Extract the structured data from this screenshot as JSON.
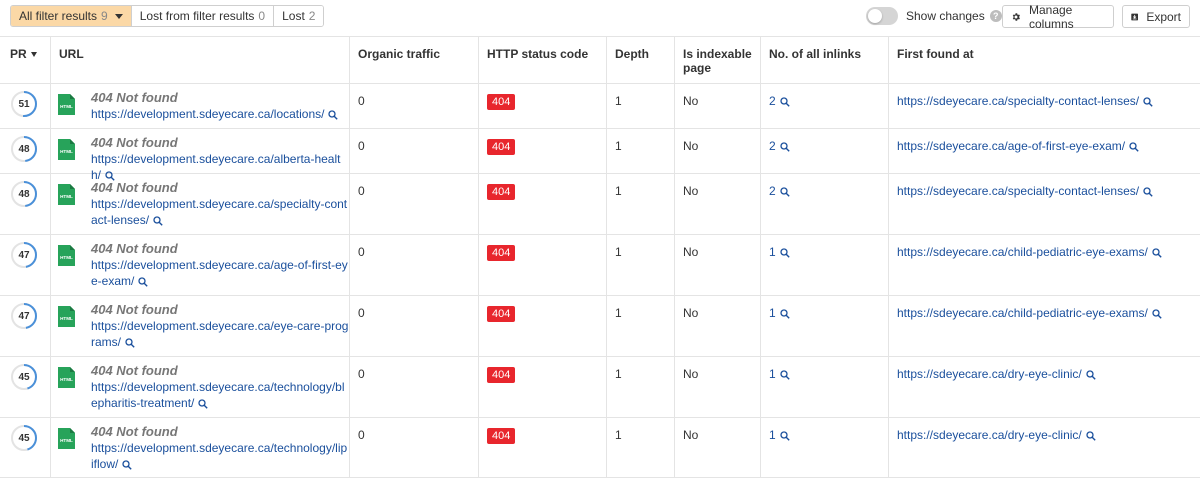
{
  "filters": {
    "all_label": "All filter results",
    "all_count": "9",
    "lost_filter_label": "Lost from filter results",
    "lost_filter_count": "0",
    "lost_label": "Lost",
    "lost_count": "2"
  },
  "toolbar": {
    "show_changes_label": "Show changes",
    "help_glyph": "?",
    "manage_columns_label": "Manage columns",
    "export_label": "Export"
  },
  "columns": {
    "pr": "PR",
    "url": "URL",
    "organic": "Organic traffic",
    "http": "HTTP status code",
    "depth": "Depth",
    "indexable": "Is indexable page",
    "inlinks": "No. of all inlinks",
    "first_found": "First found at"
  },
  "colors": {
    "accent_filter": "#fbd8a6",
    "status_404": "#e8262d",
    "link": "#1a4f9c",
    "pr_ring": "#4a90d9"
  },
  "rows": [
    {
      "pr": "51",
      "title": "404 Not found",
      "url": "https://development.sdeyecare.ca/locations/",
      "organic": "0",
      "http": "404",
      "depth": "1",
      "indexable": "No",
      "inlinks": "2",
      "first_found": "https://sdeyecare.ca/specialty-contact-lenses/"
    },
    {
      "pr": "48",
      "title": "404 Not found",
      "url": "https://development.sdeyecare.ca/alberta-health/",
      "organic": "0",
      "http": "404",
      "depth": "1",
      "indexable": "No",
      "inlinks": "2",
      "first_found": "https://sdeyecare.ca/age-of-first-eye-exam/"
    },
    {
      "pr": "48",
      "title": "404 Not found",
      "url": "https://development.sdeyecare.ca/specialty-contact-lenses/",
      "organic": "0",
      "http": "404",
      "depth": "1",
      "indexable": "No",
      "inlinks": "2",
      "first_found": "https://sdeyecare.ca/specialty-contact-lenses/"
    },
    {
      "pr": "47",
      "title": "404 Not found",
      "url": "https://development.sdeyecare.ca/age-of-first-eye-exam/",
      "organic": "0",
      "http": "404",
      "depth": "1",
      "indexable": "No",
      "inlinks": "1",
      "first_found": "https://sdeyecare.ca/child-pediatric-eye-exams/"
    },
    {
      "pr": "47",
      "title": "404 Not found",
      "url": "https://development.sdeyecare.ca/eye-care-programs/",
      "organic": "0",
      "http": "404",
      "depth": "1",
      "indexable": "No",
      "inlinks": "1",
      "first_found": "https://sdeyecare.ca/child-pediatric-eye-exams/"
    },
    {
      "pr": "45",
      "title": "404 Not found",
      "url": "https://development.sdeyecare.ca/technology/blepharitis-treatment/",
      "organic": "0",
      "http": "404",
      "depth": "1",
      "indexable": "No",
      "inlinks": "1",
      "first_found": "https://sdeyecare.ca/dry-eye-clinic/"
    },
    {
      "pr": "45",
      "title": "404 Not found",
      "url": "https://development.sdeyecare.ca/technology/lipiflow/",
      "organic": "0",
      "http": "404",
      "depth": "1",
      "indexable": "No",
      "inlinks": "1",
      "first_found": "https://sdeyecare.ca/dry-eye-clinic/"
    }
  ]
}
